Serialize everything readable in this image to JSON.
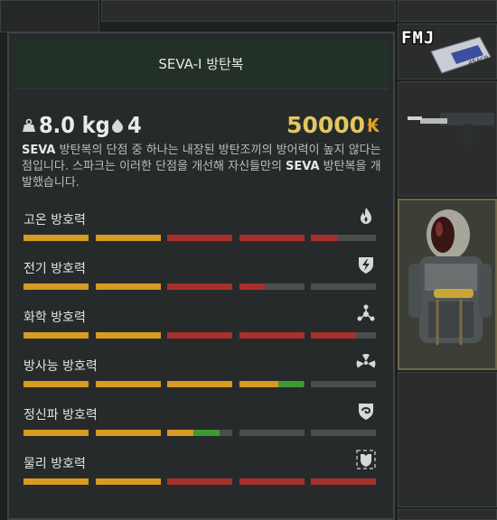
{
  "inventory": {
    "ammo_badge": "FMJ",
    "ammo_box_label": ".45ACP"
  },
  "tooltip": {
    "title": "SEVA-I 방탄복",
    "weight": "8.0 kg",
    "slots": "4",
    "price": "50000",
    "currency_symbol": "₭",
    "description": [
      {
        "text": "SEVA",
        "hl": true
      },
      {
        "text": " 방탄복의 단점 중 하나는 내장된 방탄조끼의 방어력이 높지 않다는 점입니다. 스파크는 이러한 단점을 개선해 자신들만의 ",
        "hl": false
      },
      {
        "text": "SEVA",
        "hl": true
      },
      {
        "text": " 방탄복을 개발했습니다.",
        "hl": false
      }
    ],
    "protections": [
      {
        "label": "고온 방호력",
        "icon": "fire-icon",
        "value_segments": 4.4,
        "color": "#a8302c"
      },
      {
        "label": "전기 방호력",
        "icon": "lightning-shield-icon",
        "value_segments": 3.4,
        "color": "#a8302c"
      },
      {
        "label": "화학 방호력",
        "icon": "chemical-icon",
        "value_segments": 4.7,
        "color": "#a8302c"
      },
      {
        "label": "방사능 방호력",
        "icon": "radiation-icon",
        "value_segments": 4.0,
        "color": "#3d9a32"
      },
      {
        "label": "정신파 방호력",
        "icon": "psy-shield-icon",
        "value_segments": 2.8,
        "color": "#3d9a32"
      },
      {
        "label": "물리 방호력",
        "icon": "armor-icon",
        "value_segments": 5.5,
        "color": "#a8302c"
      }
    ],
    "colors": {
      "bar_base": "#d79a22",
      "bar_empty": "#4a4e4d",
      "bar_red": "#a8302c",
      "bar_green": "#3d9a32",
      "price": "#e2c85a"
    }
  }
}
